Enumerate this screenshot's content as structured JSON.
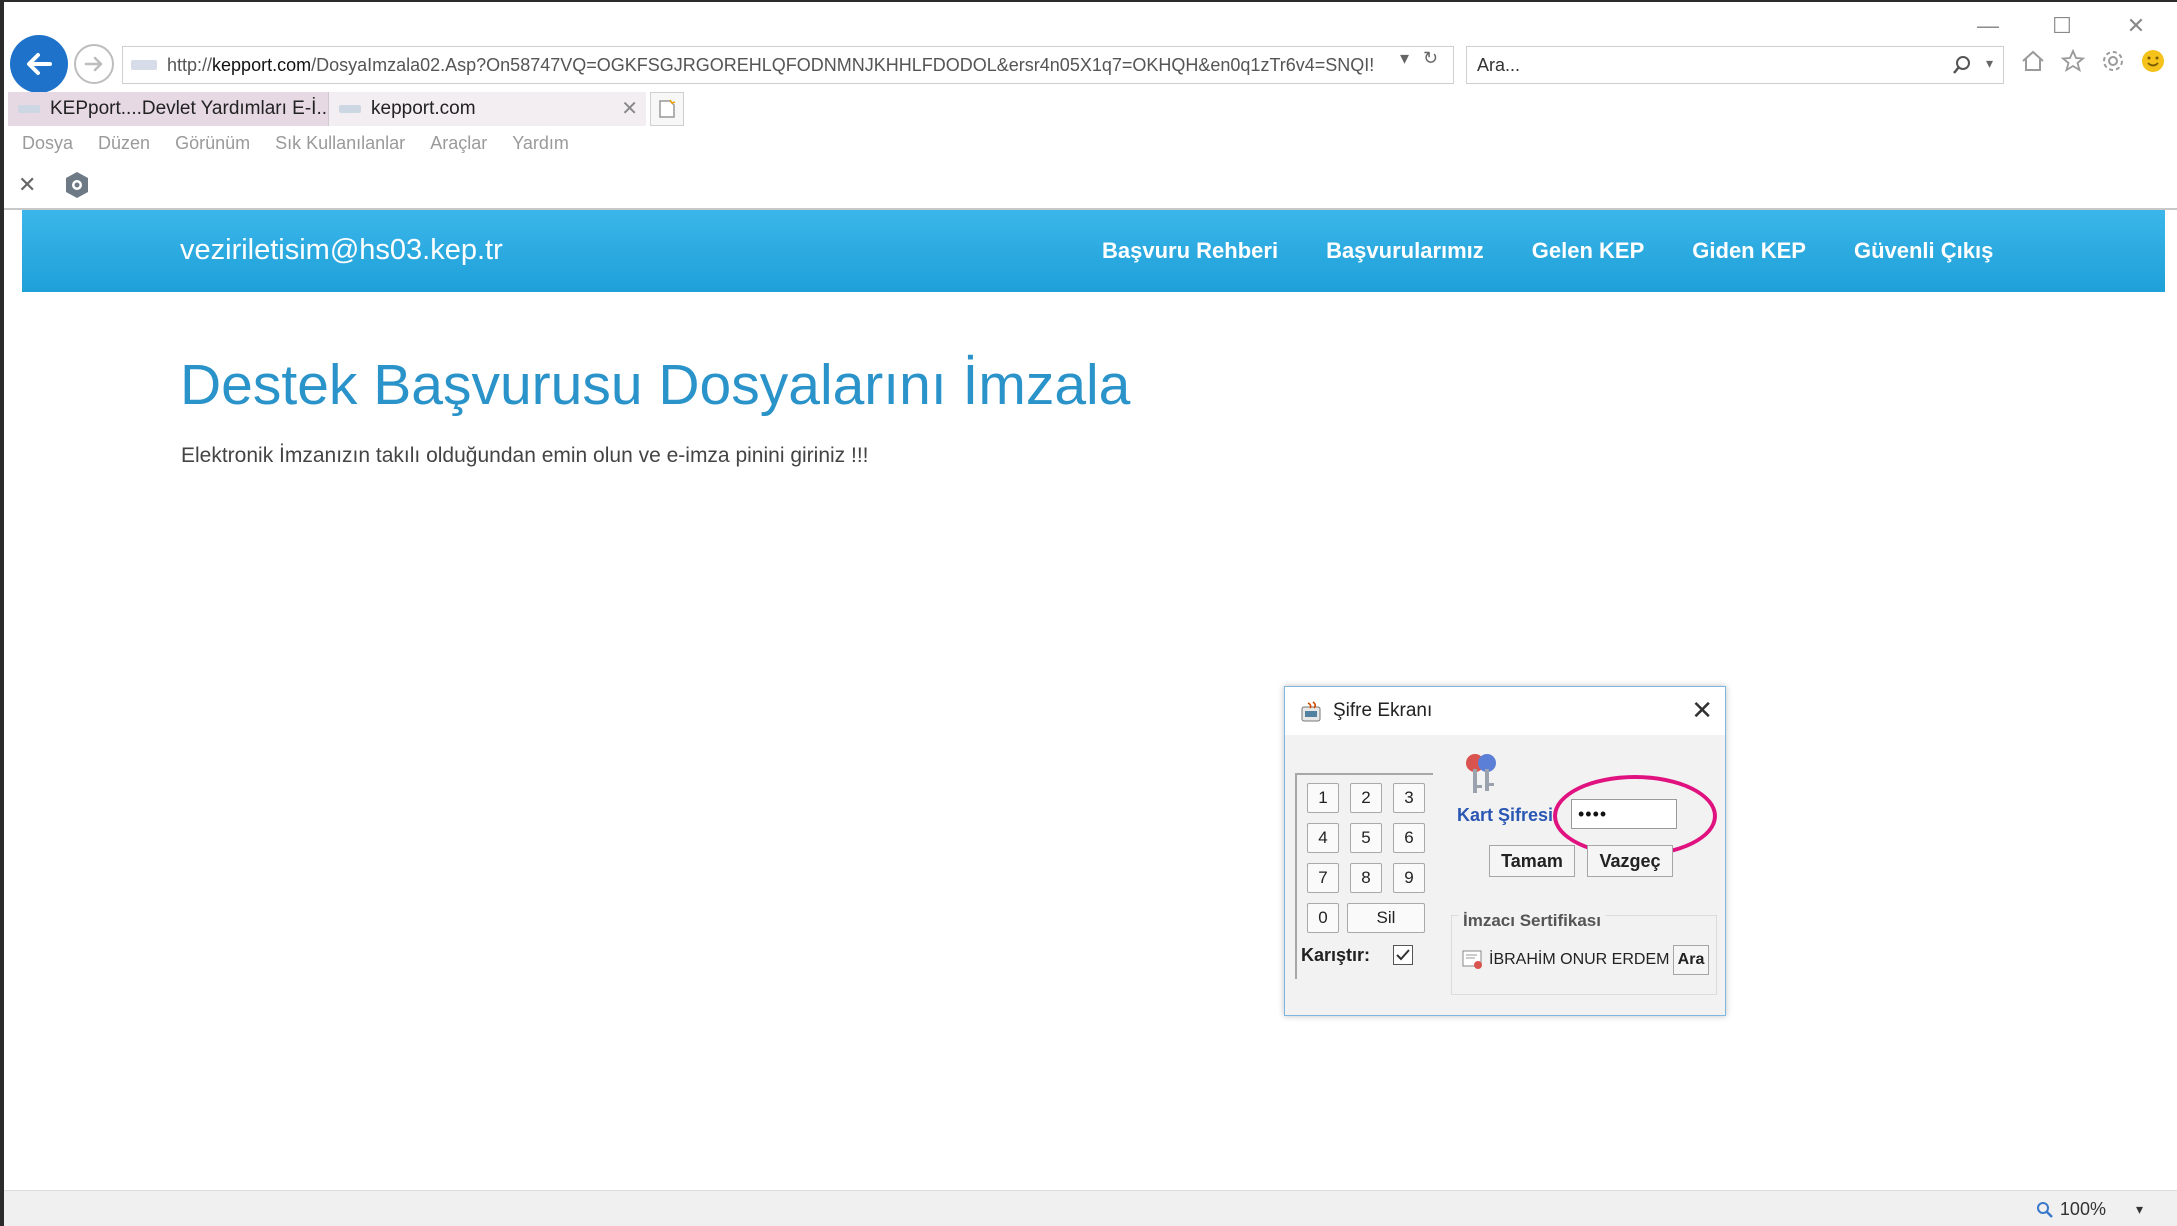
{
  "window": {
    "minimize_glyph": "—",
    "maximize_glyph": "☐",
    "close_glyph": "✕"
  },
  "browser": {
    "url_prefix": "http://",
    "url_domain": "kepport.com",
    "url_path": "/DosyaImzala02.Asp?On58747VQ=OGKFSGJRGOREHLQFODNMNJKHHLFDODOL&ersr4n05X1q7=OKHQH&en0q1zTr6v4=SNQI!",
    "search_placeholder": "Ara...",
    "tabs": [
      {
        "label": "KEPport....Devlet Yardımları E-İ..."
      },
      {
        "label": "kepport.com"
      }
    ],
    "menu": [
      "Dosya",
      "Düzen",
      "Görünüm",
      "Sık Kullanılanlar",
      "Araçlar",
      "Yardım"
    ],
    "zoom": "100%"
  },
  "site": {
    "email": "veziriletisim@hs03.kep.tr",
    "nav": [
      "Başvuru Rehberi",
      "Başvurularımız",
      "Gelen KEP",
      "Giden KEP",
      "Güvenli Çıkış"
    ],
    "title": "Destek Başvurusu Dosyalarını İmzala",
    "subtitle": "Elektronik İmzanızın takılı olduğundan emin olun ve e-imza pinini giriniz !!!"
  },
  "dialog": {
    "title": "Şifre Ekranı",
    "keys": [
      "1",
      "2",
      "3",
      "4",
      "5",
      "6",
      "7",
      "8",
      "9",
      "0",
      "Sil"
    ],
    "shuffle_label": "Karıştır:",
    "shuffle_checked": true,
    "pin_label": "Kart Şifresi:",
    "pin_value": "••••",
    "ok_label": "Tamam",
    "cancel_label": "Vazgeç",
    "cert_group_label": "İmzacı Sertifikası",
    "cert_name": "İBRAHİM ONUR ERDEM",
    "cert_button": "Ara",
    "highlight_color": "#e0127f"
  },
  "colors": {
    "header_blue": "#1ea0d8",
    "title_blue": "#2a93c9",
    "back_button": "#1e72c9"
  }
}
